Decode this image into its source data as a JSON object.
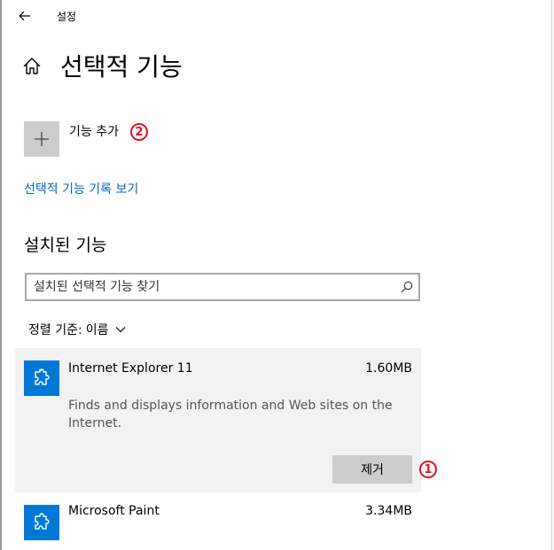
{
  "window": {
    "title": "설정"
  },
  "page": {
    "title": "선택적 기능"
  },
  "add_feature": {
    "label": "기능 추가",
    "badge": "2"
  },
  "history_link": "선택적 기능 기록 보기",
  "installed": {
    "heading": "설치된 기능",
    "search": {
      "placeholder": "설치된 선택적 기능 찾기",
      "value": ""
    },
    "sort": {
      "prefix": "정렬 기준:",
      "value": "이름"
    },
    "items": [
      {
        "name": "Internet Explorer 11",
        "size": "1.60MB",
        "description": "Finds and displays information and Web sites on the Internet.",
        "remove_label": "제거",
        "badge": "1",
        "icon": "puzzle-piece-icon"
      },
      {
        "name": "Microsoft Paint",
        "size": "3.34MB",
        "icon": "puzzle-piece-icon"
      }
    ]
  },
  "colors": {
    "accent": "#0078d7",
    "link": "#0067c0",
    "annotation": "#e81123",
    "selected_bg": "#f2f2f2",
    "button_bg": "#cccccc"
  }
}
